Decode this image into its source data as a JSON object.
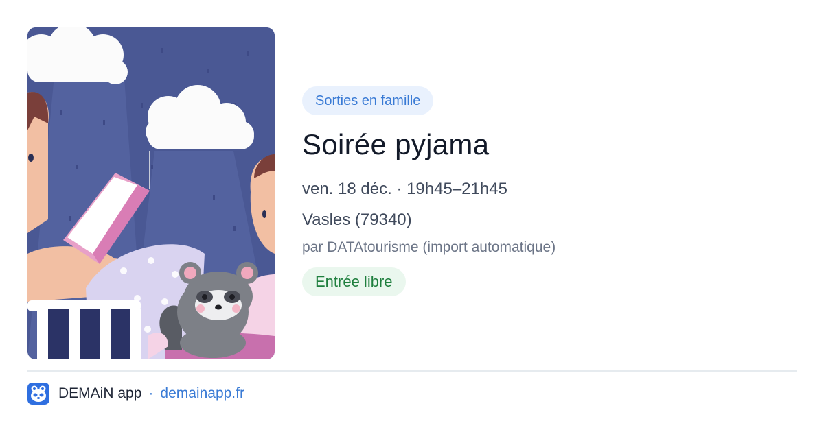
{
  "event": {
    "category": "Sorties en famille",
    "title": "Soirée pyjama",
    "datetime": "ven. 18 déc. · 19h45–21h45",
    "location": "Vasles (79340)",
    "source": "par DATAtourisme (import automatique)",
    "price": "Entrée libre"
  },
  "footer": {
    "app_name": "DEMAiN app",
    "separator": "·",
    "website": "demainapp.fr"
  },
  "icons": {
    "app": "demain-app-icon"
  },
  "colors": {
    "category_bg": "#e9f1fd",
    "category_text": "#3a7bd5",
    "price_bg": "#eaf7ee",
    "price_text": "#1f7f3e",
    "title_text": "#131a29",
    "link": "#3a7bd5"
  }
}
